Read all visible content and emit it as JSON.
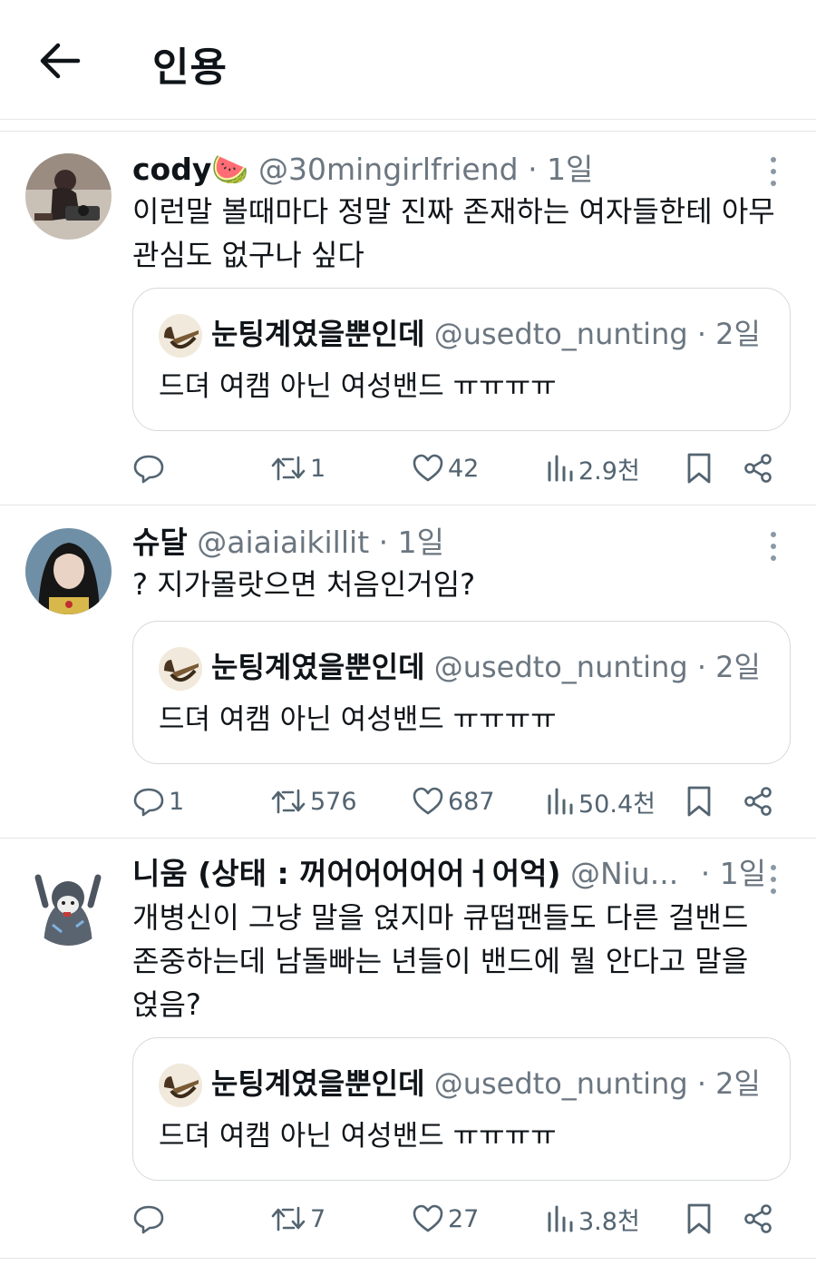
{
  "header": {
    "title": "인용"
  },
  "quoted_tweet": {
    "name": "눈팅계였을뿐인데",
    "handle": "@usedto_nunting",
    "separator": "·",
    "time": "2일",
    "text": "드뎌 여캠 아닌 여성밴드 ㅠㅠㅠㅠ"
  },
  "posts": [
    {
      "name": "cody🍉",
      "handle": "@30mingirlfriend",
      "separator": "·",
      "time": "1일",
      "text": "이런말 볼때마다 정말 진짜 존재하는 여자들한테 아무 관심도 없구나 싶다",
      "replies": "",
      "reposts": "1",
      "likes": "42",
      "views": "2.9천"
    },
    {
      "name": "슈달",
      "handle": "@aiaiaikillit",
      "separator": "·",
      "time": "1일",
      "text": "? 지가몰랏으면 처음인거임?",
      "replies": "1",
      "reposts": "576",
      "likes": "687",
      "views": "50.4천"
    },
    {
      "name": "니움 (상태 : 꺼어어어어어ㅓ어억)",
      "handle": "@Niu...",
      "separator": "·",
      "time": "1일",
      "text": "개병신이 그냥 말을 얹지마 큐떱팬들도 다른 걸밴드 존중하는데 남돌빠는 년들이 밴드에 뭘 안다고 말을 얹음?",
      "replies": "",
      "reposts": "7",
      "likes": "27",
      "views": "3.8천"
    }
  ],
  "icons": {
    "back": "arrow-left-icon",
    "more": "more-vertical-icon",
    "reply": "reply-icon",
    "repost": "repost-icon",
    "like": "heart-icon",
    "views": "views-icon",
    "bookmark": "bookmark-icon",
    "share": "share-icon"
  },
  "colors": {
    "text": "#0f1419",
    "secondary": "#536471",
    "border": "#e4e4e4"
  }
}
